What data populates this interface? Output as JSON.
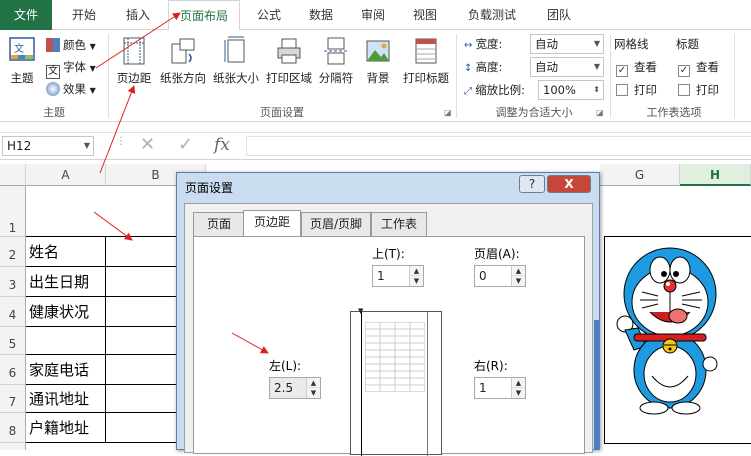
{
  "tabs": [
    {
      "label": "文件",
      "key": "file"
    },
    {
      "label": "开始",
      "key": "home"
    },
    {
      "label": "插入",
      "key": "insert"
    },
    {
      "label": "页面布局",
      "key": "layout"
    },
    {
      "label": "公式",
      "key": "formulas"
    },
    {
      "label": "数据",
      "key": "data"
    },
    {
      "label": "审阅",
      "key": "review"
    },
    {
      "label": "视图",
      "key": "view"
    },
    {
      "label": "负载测试",
      "key": "loadtest"
    },
    {
      "label": "团队",
      "key": "team"
    }
  ],
  "ribbon": {
    "theme": {
      "theme_label": "主题",
      "colors_label": "颜色",
      "fonts_label": "字体",
      "effects_label": "效果",
      "group_label": "主题"
    },
    "page_setup": {
      "margins": "页边距",
      "orientation": "纸张方向",
      "size": "纸张大小",
      "print_area": "打印区域",
      "breaks": "分隔符",
      "background": "背景",
      "print_titles": "打印标题",
      "group_label": "页面设置"
    },
    "scale": {
      "width_label": "宽度:",
      "width_value": "自动",
      "height_label": "高度:",
      "height_value": "自动",
      "scale_label": "缩放比例:",
      "scale_value": "100%",
      "group_label": "调整为合适大小"
    },
    "sheet_options": {
      "gridlines_label": "网格线",
      "headings_label": "标题",
      "view_label": "查看",
      "print_label": "打印",
      "group_label": "工作表选项"
    }
  },
  "formula_bar": {
    "name_box": "H12",
    "fx": "fx"
  },
  "grid": {
    "columns": [
      "A",
      "B",
      "G",
      "H"
    ],
    "row_numbers": [
      "1",
      "2",
      "3",
      "4",
      "5",
      "6",
      "7",
      "8"
    ],
    "cells_a": [
      "",
      "姓名",
      "出生日期",
      "健康状况",
      "",
      "家庭电话",
      "通讯地址",
      "户籍地址"
    ]
  },
  "dialog": {
    "title": "页面设置",
    "help_btn": "?",
    "close_btn": "X",
    "tabs": [
      "页面",
      "页边距",
      "页眉/页脚",
      "工作表"
    ],
    "active_tab": "页边距",
    "top_label": "上(T):",
    "top_value": "1",
    "header_label": "页眉(A):",
    "header_value": "0",
    "left_label": "左(L):",
    "left_value": "2.5",
    "right_label": "右(R):",
    "right_value": "1"
  },
  "colors": {
    "file_tab": "#217346",
    "active_tab_text": "#217346",
    "arrow": "#e02020",
    "dialog_frame": "#c9dcf0"
  }
}
